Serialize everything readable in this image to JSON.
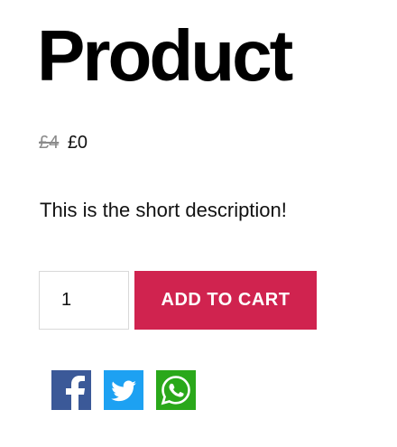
{
  "product": {
    "title": "Product",
    "price_old": "£4",
    "price_new": "£0",
    "short_description": "This is the short description!"
  },
  "cart": {
    "quantity": "1",
    "add_to_cart_label": "ADD TO CART",
    "button_color": "#d0234f"
  },
  "share": {
    "icons": [
      "facebook-icon",
      "twitter-icon",
      "whatsapp-icon"
    ],
    "colors": {
      "facebook": "#3b5998",
      "twitter": "#1da1f2",
      "whatsapp": "#2aa81a"
    }
  }
}
